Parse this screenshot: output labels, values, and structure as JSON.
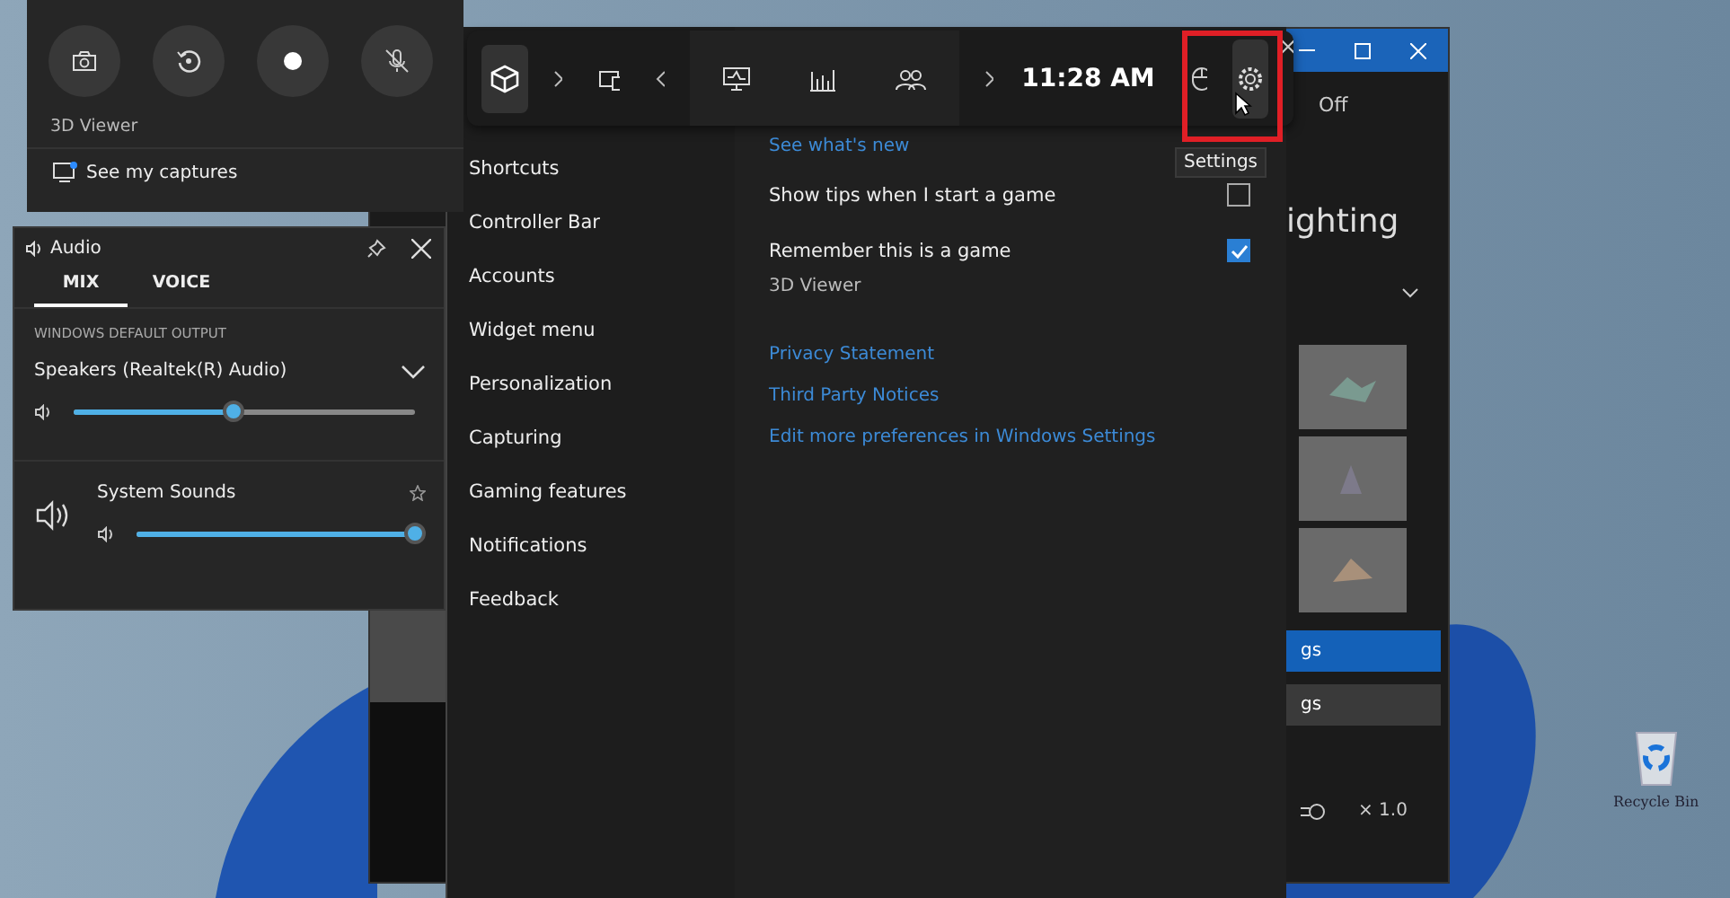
{
  "capture_widget": {
    "app_name": "3D Viewer",
    "captures_link": "See my captures"
  },
  "audio_widget": {
    "title": "Audio",
    "tabs": [
      {
        "label": "MIX",
        "selected": true
      },
      {
        "label": "VOICE",
        "selected": false
      }
    ],
    "section_label": "WINDOWS DEFAULT OUTPUT",
    "device": "Speakers (Realtek(R) Audio)",
    "level": 0.47,
    "apps": [
      {
        "name": "System Sounds",
        "level": 1.0
      }
    ]
  },
  "viewer_window": {
    "toggle_label": "Off",
    "heading": "ighting",
    "buttons": [
      {
        "label": "gs",
        "kind": "primary"
      },
      {
        "label": "gs",
        "kind": "secondary"
      }
    ],
    "zoom": "× 1.0"
  },
  "settings_window": {
    "nav": [
      "Shortcuts",
      "Controller Bar",
      "Accounts",
      "Widget menu",
      "Personalization",
      "Capturing",
      "Gaming features",
      "Notifications",
      "Feedback"
    ],
    "top_link": "See what's new",
    "options": [
      {
        "label": "Show tips when I start a game",
        "checked": false
      },
      {
        "label": "Remember this is a game",
        "checked": true,
        "detail": "3D Viewer"
      }
    ],
    "links": [
      "Privacy Statement",
      "Third Party Notices",
      "Edit more preferences in Windows Settings"
    ]
  },
  "game_bar": {
    "time": "11:28 AM",
    "tooltip": "Settings"
  },
  "desktop": {
    "recycle_bin": "Recycle Bin"
  }
}
